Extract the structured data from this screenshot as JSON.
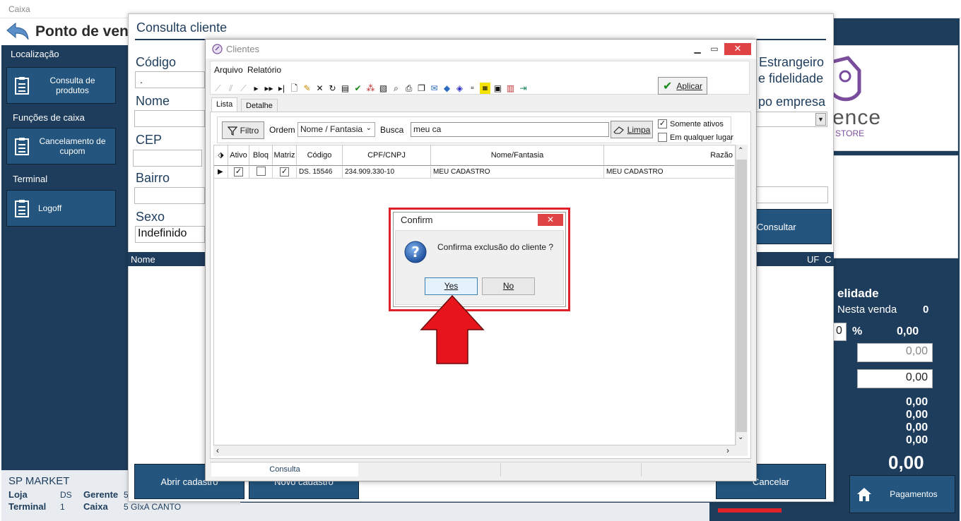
{
  "app": {
    "title": "Caixa",
    "header_title": "Ponto de venda"
  },
  "sidebar": {
    "sections": [
      {
        "label": "Localização",
        "button": "Consulta de produtos"
      },
      {
        "label": "Funções de caixa",
        "button": "Cancelamento de cupom"
      },
      {
        "label": "Terminal",
        "button": "Logoff"
      }
    ]
  },
  "store": {
    "name": "SP MARKET",
    "loja_label": "Loja",
    "loja_value": "DS",
    "gerente_label": "Gerente",
    "gerente_value": "5",
    "terminal_label": "Terminal",
    "terminal_value": "1",
    "caixa_label": "Caixa",
    "caixa_value": "5 GIxA CANTO"
  },
  "right_panel": {
    "logo_text": "ence",
    "logo_sub": "STORE",
    "estrangeiro": "Estrangeiro",
    "fidelidade_opt": "e fidelidade",
    "tipo_empresa": "po empresa",
    "consultar": "Consultar",
    "uf": "UF",
    "c_col": "C",
    "fidelidade": "elidade",
    "nesta_venda": "Nesta venda",
    "nesta_venda_value": "0",
    "pct_input": "0",
    "pct_symbol": "%",
    "pct_value": "0,00",
    "box1": "0,00",
    "box2": "0,00",
    "sum1": "0,00",
    "sum2": "0,00",
    "sum3": "0,00",
    "sum4": "0,00",
    "total": "0,00",
    "pagamentos": "Pagamentos"
  },
  "consulta_cliente": {
    "title": "Consulta cliente",
    "codigo_label": "Código",
    "codigo_value": ".",
    "nome_label": "Nome",
    "cep_label": "CEP",
    "bairro_label": "Bairro",
    "sexo_label": "Sexo",
    "sexo_value": "Indefinido",
    "grid_nome": "Nome",
    "abrir_cadastro": "Abrir cadastro",
    "novo_cadastro": "Novo cadastro",
    "cancelar": "Cancelar",
    "dot": "."
  },
  "clientes": {
    "title": "Clientes",
    "menu": [
      "Arquivo",
      "Relatório"
    ],
    "aplicar": "Aplicar",
    "tabs": [
      "Lista",
      "Detalhe"
    ],
    "filtro": "Filtro",
    "ordem_label": "Ordem",
    "ordem_value": "Nome / Fantasia",
    "busca_label": "Busca",
    "busca_value": "meu ca",
    "limpa": "Limpa",
    "somente_ativos": "Somente ativos",
    "em_qualquer_lugar": "Em qualquer lugar",
    "columns": [
      "Ativo",
      "Bloq",
      "Matriz",
      "Código",
      "CPF/CNPJ",
      "Nome/Fantasia",
      "Razão"
    ],
    "row": {
      "ativo": "✓",
      "bloq": "",
      "matriz": "✓",
      "codigo": "DS. 15546",
      "cpf": "234.909.330-10",
      "nome": "MEU CADASTRO",
      "razao": "MEU CADASTRO"
    },
    "status_tab": "Consulta"
  },
  "confirm": {
    "title": "Confirm",
    "message": "Confirma exclusão do cliente ?",
    "yes": "Yes",
    "no": "No"
  },
  "colors": {
    "navy": "#1e3d5c",
    "button_blue": "#23557f",
    "highlight_red": "#e02128",
    "close_red": "#e04343"
  }
}
